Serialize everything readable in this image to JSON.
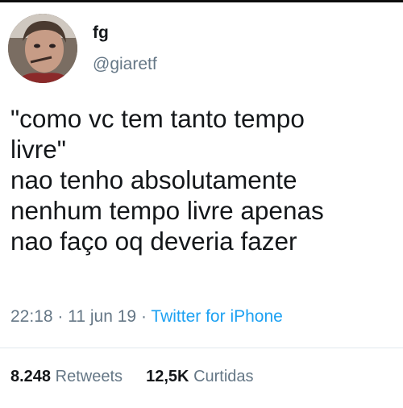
{
  "tweet": {
    "author": {
      "name": "fg",
      "handle": "@giaretf"
    },
    "text_lines": [
      "\"como vc tem tanto tempo",
      "livre\"",
      "nao tenho absolutamente",
      "nenhum tempo livre apenas",
      "nao faço oq deveria fazer"
    ],
    "time": "22:18",
    "date": "11 jun 19",
    "source": "Twitter for iPhone",
    "separator": "·",
    "retweets_count": "8.248",
    "retweets_label": "Retweets",
    "likes_count": "12,5K",
    "likes_label": "Curtidas"
  },
  "colors": {
    "text": "#14171a",
    "secondary": "#657786",
    "link": "#1da1f2"
  }
}
